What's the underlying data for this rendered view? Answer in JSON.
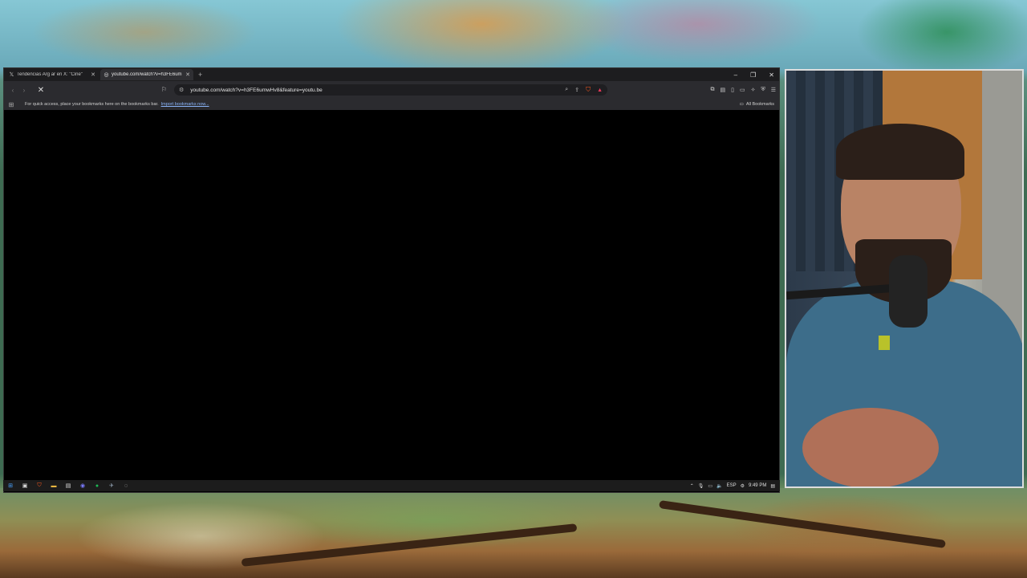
{
  "browser": {
    "tabs": [
      {
        "title": "Tendencias Arg ar en X: \"Cine\"",
        "active": false,
        "icon": "x-logo-icon"
      },
      {
        "title": "youtube.com/watch?v=h3FE6um",
        "active": true,
        "icon": "globe-icon"
      }
    ],
    "new_tab": "+",
    "window_controls": [
      "–",
      "❐",
      "✕"
    ],
    "url": "youtube.com/watch?v=h3FE6umwHv8&feature=youtu.be",
    "bookmarks_message": "For quick access, place your bookmarks here on the bookmarks bar.",
    "bookmarks_import_link": "Import bookmarks now...",
    "all_bookmarks": "All Bookmarks",
    "accent_color": "#ff5a1f"
  },
  "taskbar": {
    "language": "ESP",
    "time": "9:49 PM"
  }
}
